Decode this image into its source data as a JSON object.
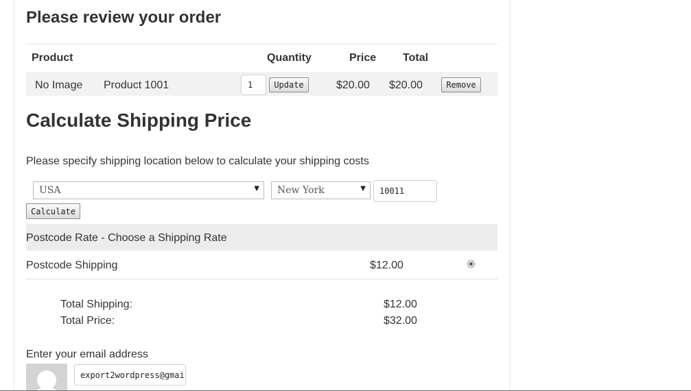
{
  "order": {
    "title": "Please review your order",
    "headers": {
      "product": "Product",
      "quantity": "Quantity",
      "price": "Price",
      "total": "Total"
    },
    "item": {
      "image": "No Image",
      "name": "Product 1001",
      "quantity": "1",
      "update_label": "Update",
      "price": "$20.00",
      "total": "$20.00",
      "remove_label": "Remove"
    }
  },
  "shipping": {
    "title": "Calculate Shipping Price",
    "instructions": "Please specify shipping location below to calculate your shipping costs",
    "country": "USA",
    "state": "New York",
    "postcode": "10011",
    "calculate_label": "Calculate",
    "rate_header": "Postcode Rate - Choose a Shipping Rate",
    "rate_name": "Postcode Shipping",
    "rate_price": "$12.00",
    "rate_selected": true
  },
  "totals": {
    "shipping_label": "Total Shipping:",
    "shipping_value": "$12.00",
    "price_label": "Total Price:",
    "price_value": "$32.00"
  },
  "email": {
    "label": "Enter your email address",
    "value": "export2wordpress@gmai"
  },
  "icons": {
    "select_arrow": "▼",
    "avatar": "avatar-placeholder-icon"
  }
}
